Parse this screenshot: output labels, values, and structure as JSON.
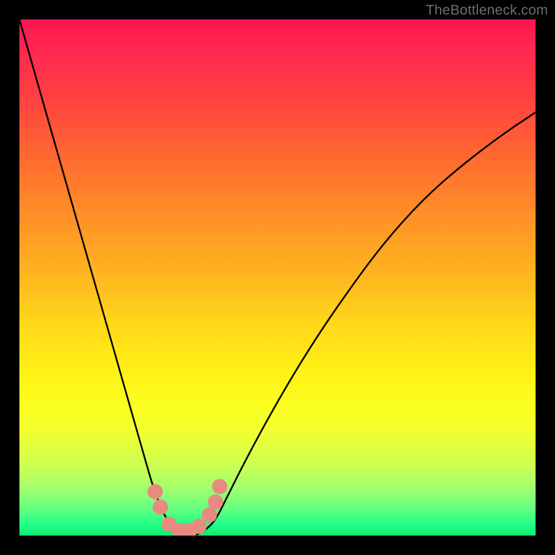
{
  "watermark": "TheBottleneck.com",
  "chart_data": {
    "type": "line",
    "title": "",
    "xlabel": "",
    "ylabel": "",
    "xlim": [
      0,
      1
    ],
    "ylim": [
      0,
      1
    ],
    "series": [
      {
        "name": "bottleneck-curve",
        "x": [
          0.0,
          0.04,
          0.08,
          0.12,
          0.16,
          0.2,
          0.24,
          0.26,
          0.28,
          0.3,
          0.32,
          0.34,
          0.36,
          0.38,
          0.4,
          0.44,
          0.5,
          0.56,
          0.62,
          0.7,
          0.78,
          0.86,
          0.94,
          1.0
        ],
        "y": [
          1.0,
          0.86,
          0.72,
          0.58,
          0.44,
          0.3,
          0.16,
          0.09,
          0.04,
          0.01,
          0.0,
          0.0,
          0.01,
          0.03,
          0.07,
          0.15,
          0.26,
          0.36,
          0.45,
          0.56,
          0.65,
          0.72,
          0.78,
          0.82
        ]
      }
    ],
    "markers": {
      "name": "highlight-dots",
      "color": "#e88a80",
      "points": [
        {
          "x": 0.263,
          "y": 0.085
        },
        {
          "x": 0.273,
          "y": 0.055
        },
        {
          "x": 0.29,
          "y": 0.022
        },
        {
          "x": 0.31,
          "y": 0.01
        },
        {
          "x": 0.33,
          "y": 0.01
        },
        {
          "x": 0.348,
          "y": 0.018
        },
        {
          "x": 0.368,
          "y": 0.04
        },
        {
          "x": 0.38,
          "y": 0.065
        },
        {
          "x": 0.388,
          "y": 0.095
        }
      ]
    }
  }
}
